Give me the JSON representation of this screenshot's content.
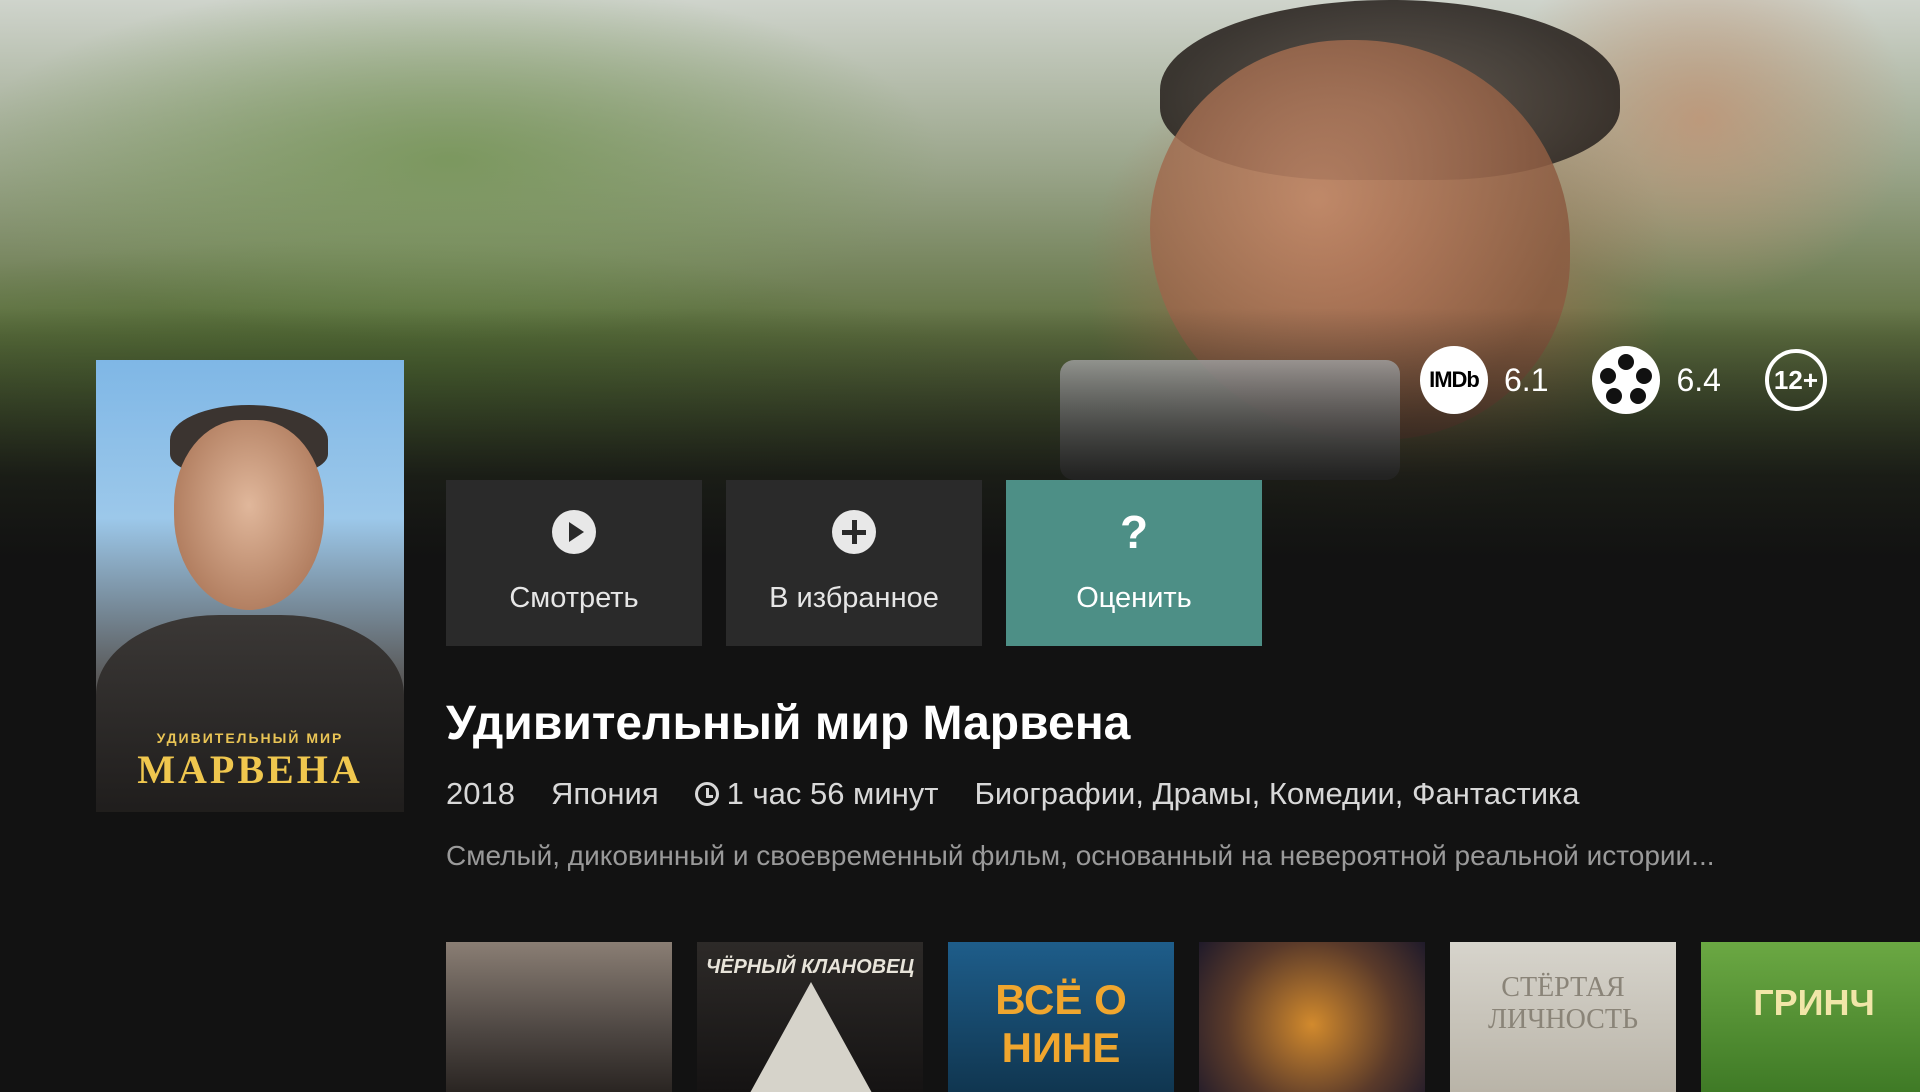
{
  "movie": {
    "title": "Удивительный мир Марвена",
    "year": "2018",
    "country": "Япония",
    "duration": "1 час 56 минут",
    "genres": "Биографии, Драмы, Комедии, Фантастика",
    "description": "Смелый, диковинный и своевременный фильм, основанный на невероятной реальной истории..."
  },
  "poster": {
    "small_title": "УДИВИТЕЛЬНЫЙ МИР",
    "big_title": "МАРВЕНА"
  },
  "ratings": {
    "imdb_label": "IMDb",
    "imdb": "6.1",
    "kinopoisk": "6.4",
    "age": "12+"
  },
  "actions": {
    "watch": "Смотреть",
    "favorite": "В избранное",
    "rate": "Оценить",
    "rate_icon": "?"
  },
  "related": [
    {
      "title": ""
    },
    {
      "title": "ЧЁРНЫЙ КЛАНОВЕЦ"
    },
    {
      "title": "ВСЁ О НИНЕ"
    },
    {
      "title": ""
    },
    {
      "title": "СТЁРТАЯ ЛИЧНОСТЬ"
    },
    {
      "title": "ГРИНЧ"
    }
  ],
  "colors": {
    "background": "#121212",
    "accent": "#4d8f86",
    "button": "#2a2a2a"
  }
}
